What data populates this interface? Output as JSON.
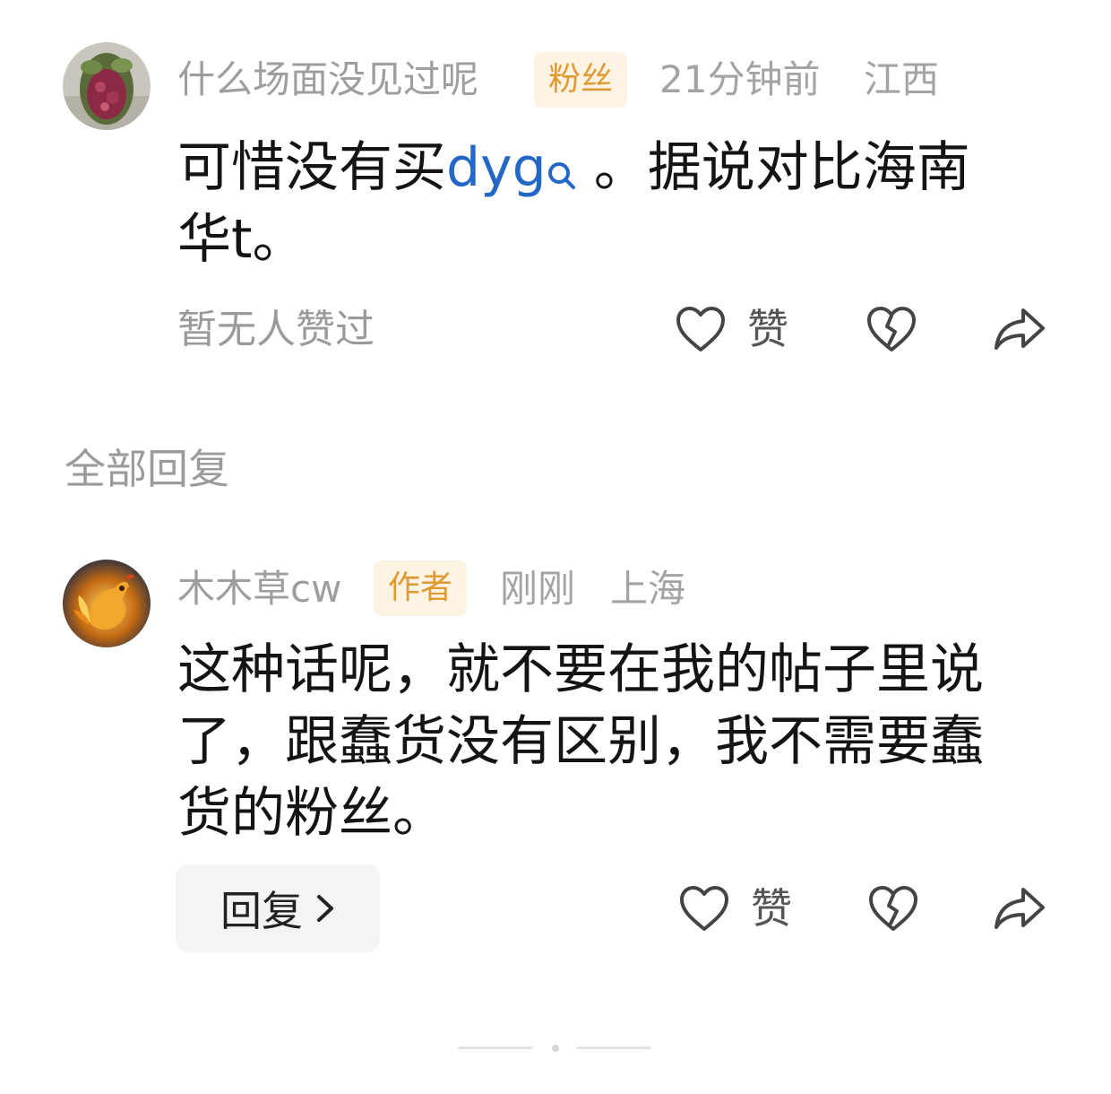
{
  "comment": {
    "username": "什么场面没见过呢",
    "badge": "粉丝",
    "time": "21分钟前",
    "location": "江西",
    "text_part1": "可惜没有买",
    "link_text": "dyg",
    "text_part2": " 。据说对比海南",
    "text_line2": "华t。",
    "likes_status": "暂无人赞过",
    "like_label": "赞"
  },
  "section": {
    "title": "全部回复"
  },
  "reply": {
    "username": "木木草cw",
    "badge": "作者",
    "time": "刚刚",
    "location": "上海",
    "lines": [
      "这种话呢，就不要在我的帖子里说",
      "了，跟蠢货没有区别，我不需要蠢",
      "货的粉丝。"
    ],
    "reply_button_label": "回复",
    "like_label": "赞"
  },
  "colors": {
    "badge_bg": "#fdf3e3",
    "badge_text": "#e09a33",
    "link": "#2468c7",
    "meta": "#9e9e9e"
  },
  "icons": [
    "heart-icon",
    "broken-heart-icon",
    "share-arrow-icon",
    "search-icon",
    "chevron-right-icon"
  ]
}
